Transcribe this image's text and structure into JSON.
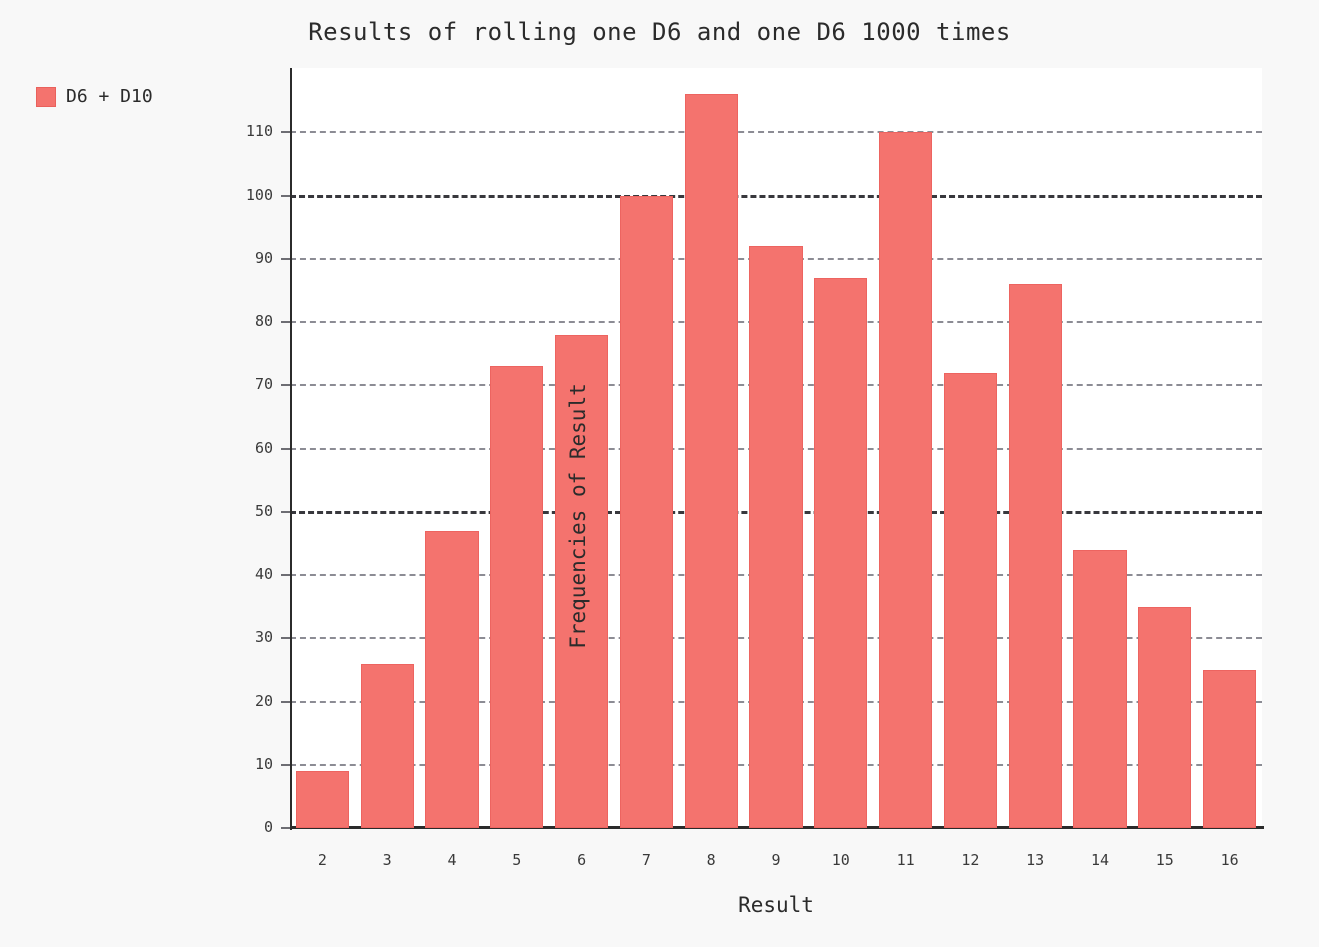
{
  "chart_data": {
    "type": "bar",
    "title": "Results of rolling one D6 and one D6 1000 times",
    "xlabel": "Result",
    "ylabel": "Frequencies of Result",
    "categories": [
      "2",
      "3",
      "4",
      "5",
      "6",
      "7",
      "8",
      "9",
      "10",
      "11",
      "12",
      "13",
      "14",
      "15",
      "16"
    ],
    "values": [
      9,
      26,
      47,
      73,
      78,
      100,
      116,
      92,
      87,
      110,
      72,
      86,
      44,
      35,
      25
    ],
    "series": [
      {
        "name": "D6 + D10",
        "color": "#f4736e",
        "values": [
          9,
          26,
          47,
          73,
          78,
          100,
          116,
          92,
          87,
          110,
          72,
          86,
          44,
          35,
          25
        ]
      }
    ],
    "ylim": [
      0,
      120
    ],
    "yticks": [
      "0",
      "10",
      "20",
      "30",
      "40",
      "50",
      "60",
      "70",
      "80",
      "90",
      "100",
      "110"
    ],
    "ytick_values": [
      0,
      10,
      20,
      30,
      40,
      50,
      60,
      70,
      80,
      90,
      100,
      110
    ],
    "major_gridlines": [
      50,
      100
    ],
    "grid": true,
    "legend_position": "top-left",
    "legend": [
      {
        "label": "D6 + D10",
        "color": "#f4736e"
      }
    ]
  },
  "colors": {
    "page_background": "#f8f8f8",
    "plot_background": "#ffffff",
    "bar_fill": "#f4736e",
    "bar_stroke": "#ed6460",
    "axis": "#2b2b2b",
    "gridline": "#8c8c94",
    "gridline_major": "#38383d",
    "text": "#2b2b2b"
  }
}
